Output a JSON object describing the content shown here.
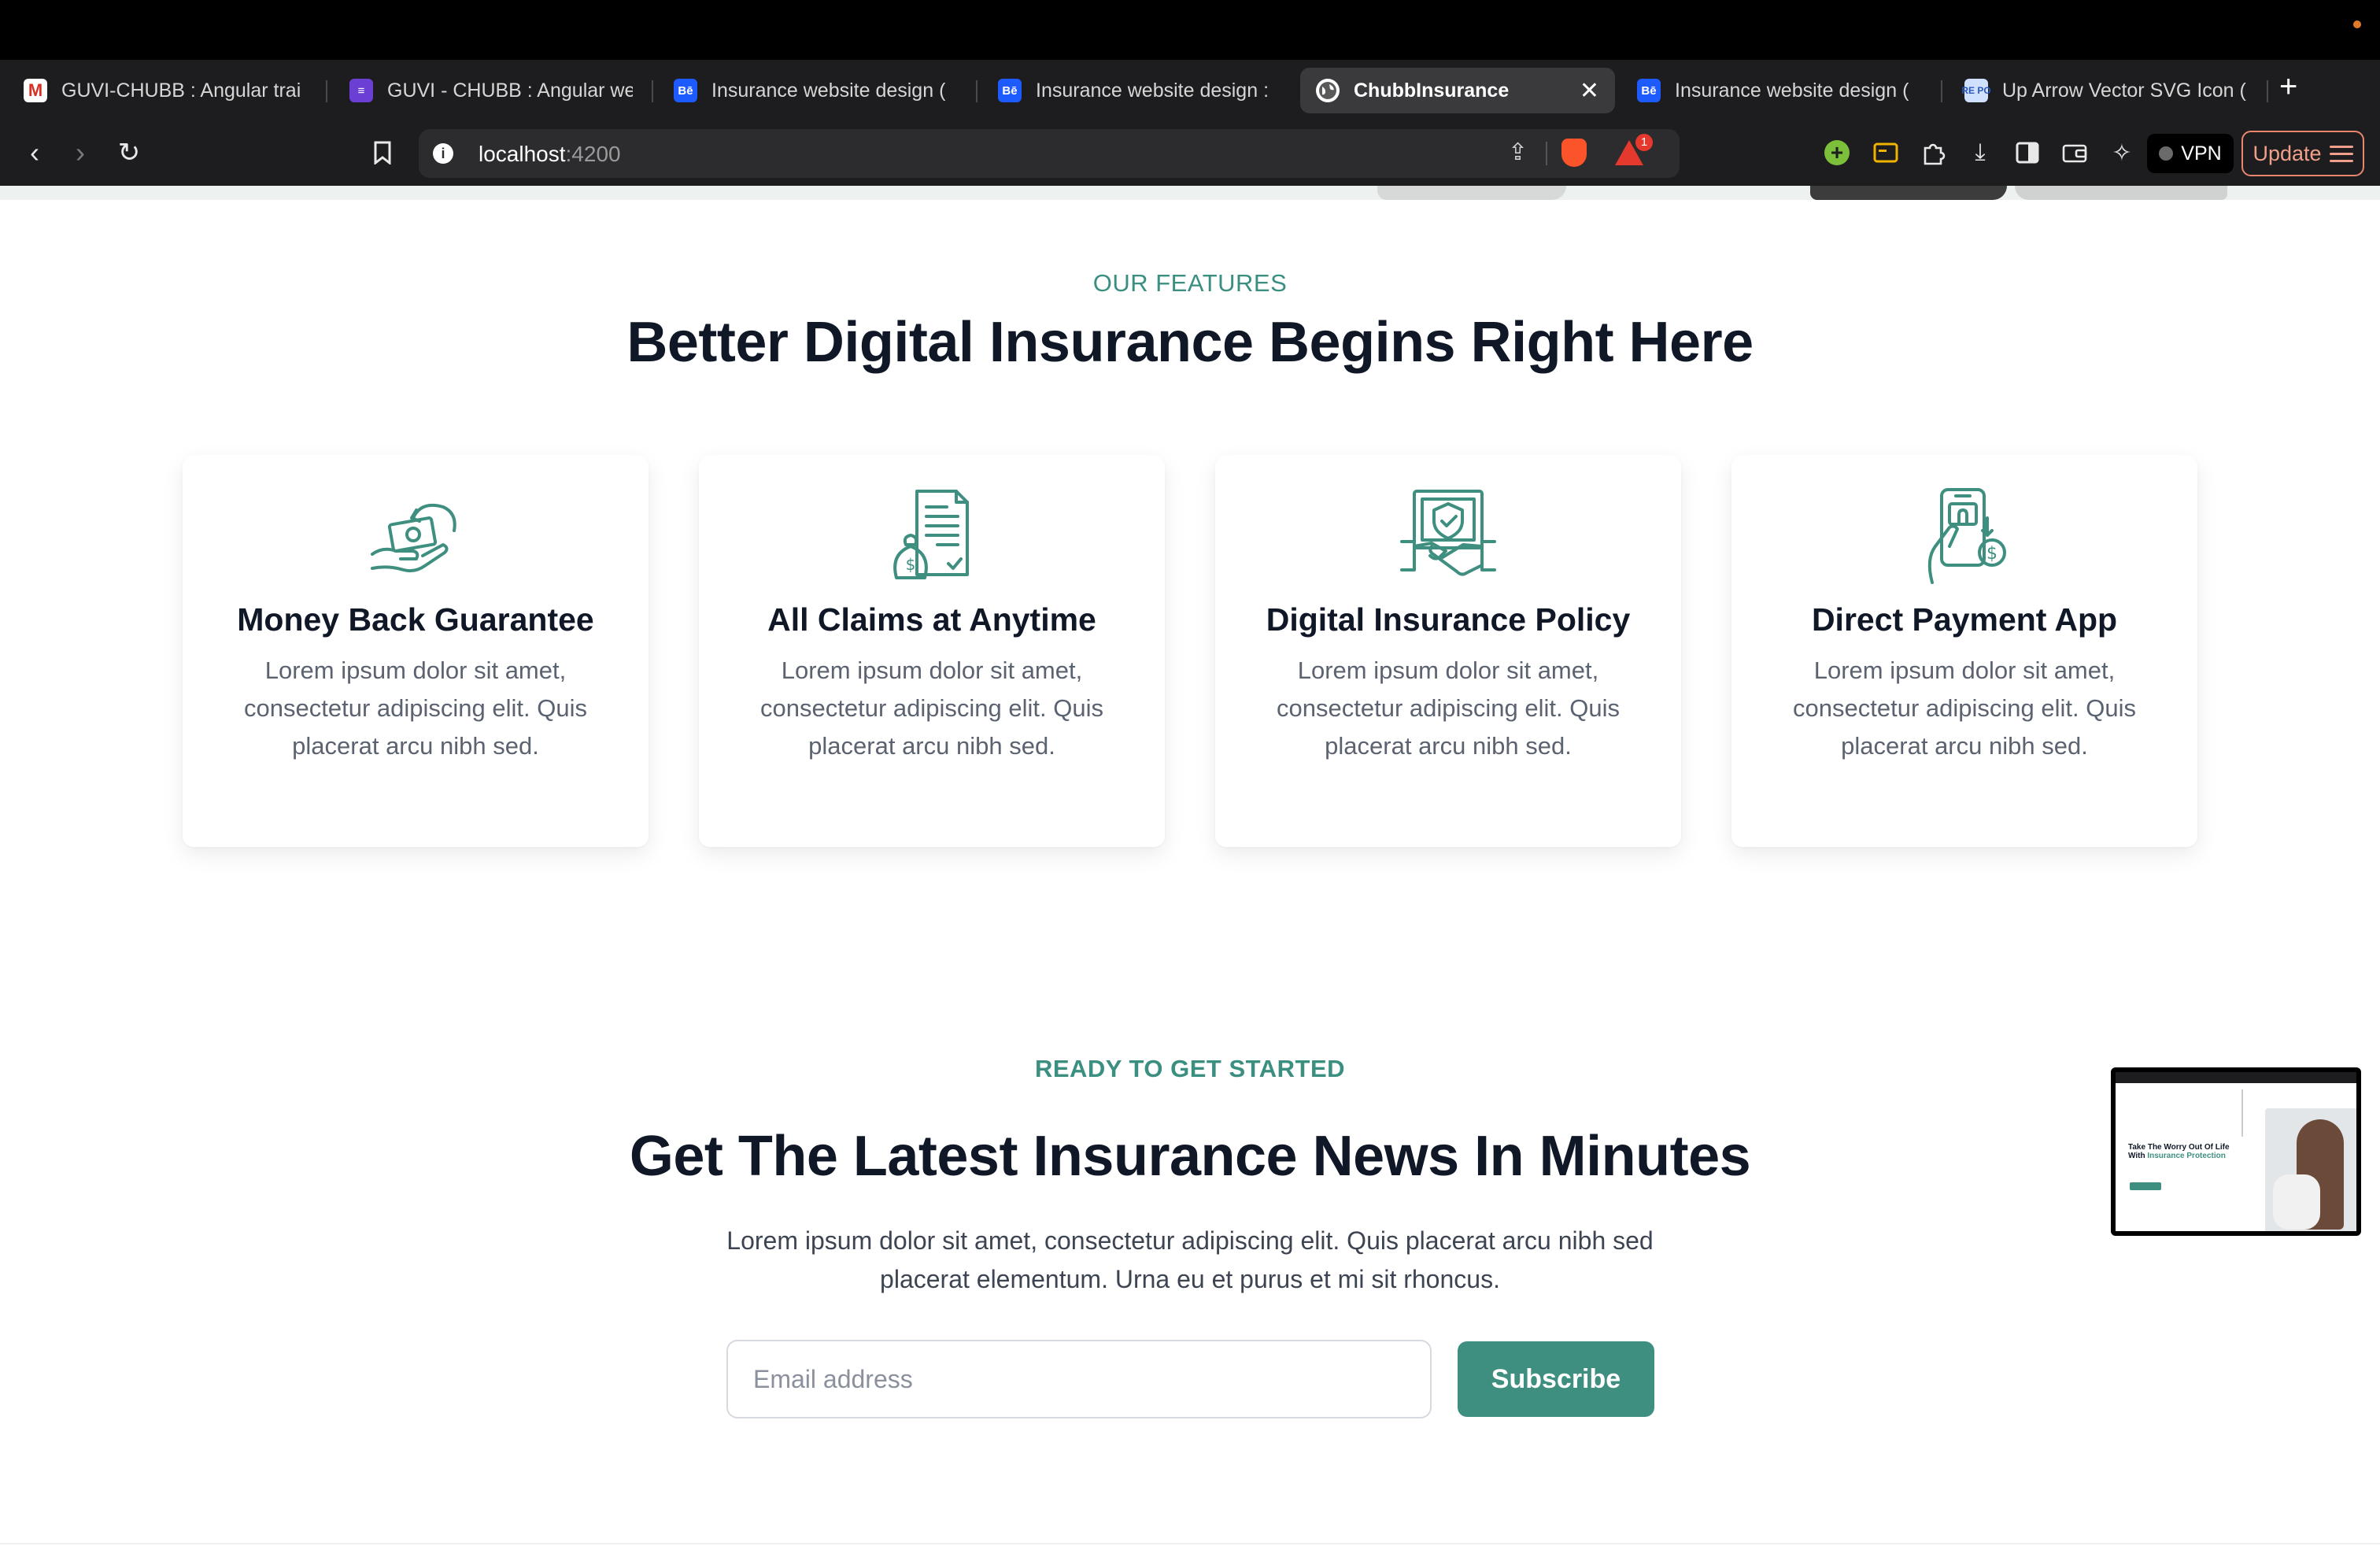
{
  "browser": {
    "tabs": [
      {
        "title": "GUVI-CHUBB : Angular trai",
        "favicon": "gmail-icon"
      },
      {
        "title": "GUVI - CHUBB : Angular we",
        "favicon": "forms-icon"
      },
      {
        "title": "Insurance website design (",
        "favicon": "behance-icon"
      },
      {
        "title": "Insurance website design :",
        "favicon": "behance-icon"
      },
      {
        "title": "ChubbInsurance",
        "favicon": "globe-icon",
        "active": true
      },
      {
        "title": "Insurance website design (",
        "favicon": "behance-icon"
      },
      {
        "title": "Up Arrow Vector SVG Icon (",
        "favicon": "svgrepo-icon"
      }
    ],
    "url": {
      "host": "localhost",
      "port": ":4200"
    },
    "bat_badge": "1",
    "vpn_label": "VPN",
    "update_label": "Update",
    "favicon_letters": {
      "gmail": "M",
      "behance": "Bē",
      "repo": "RE PO"
    }
  },
  "features": {
    "eyebrow": "OUR FEATURES",
    "title": "Better Digital Insurance Begins Right Here",
    "cards": [
      {
        "title": "Money Back Guarantee",
        "text": "Lorem ipsum dolor sit amet, consectetur adipiscing elit. Quis placerat arcu nibh sed.",
        "icon": "money-back-icon"
      },
      {
        "title": "All Claims at Anytime",
        "text": "Lorem ipsum dolor sit amet, consectetur adipiscing elit. Quis placerat arcu nibh sed.",
        "icon": "claims-document-icon"
      },
      {
        "title": "Digital Insurance Policy",
        "text": "Lorem ipsum dolor sit amet, consectetur adipiscing elit. Quis placerat arcu nibh sed.",
        "icon": "handshake-shield-icon"
      },
      {
        "title": "Direct Payment App",
        "text": "Lorem ipsum dolor sit amet, consectetur adipiscing elit. Quis placerat arcu nibh sed.",
        "icon": "phone-payment-icon"
      }
    ]
  },
  "newsletter": {
    "eyebrow": "READY TO GET STARTED",
    "title": "Get The Latest Insurance News In Minutes",
    "description": "Lorem ipsum dolor sit amet, consectetur adipiscing elit. Quis placerat arcu nibh sed placerat elementum. Urna eu et purus et mi sit rhoncus.",
    "email_placeholder": "Email address",
    "email_value": "",
    "subscribe_label": "Subscribe"
  },
  "pip_preview": {
    "title_part1": "Take The Worry Out Of Life With",
    "title_accent": "Insurance Protection"
  },
  "colors": {
    "accent": "#3f8f80",
    "heading": "#101828",
    "body_text": "#5b6270"
  }
}
